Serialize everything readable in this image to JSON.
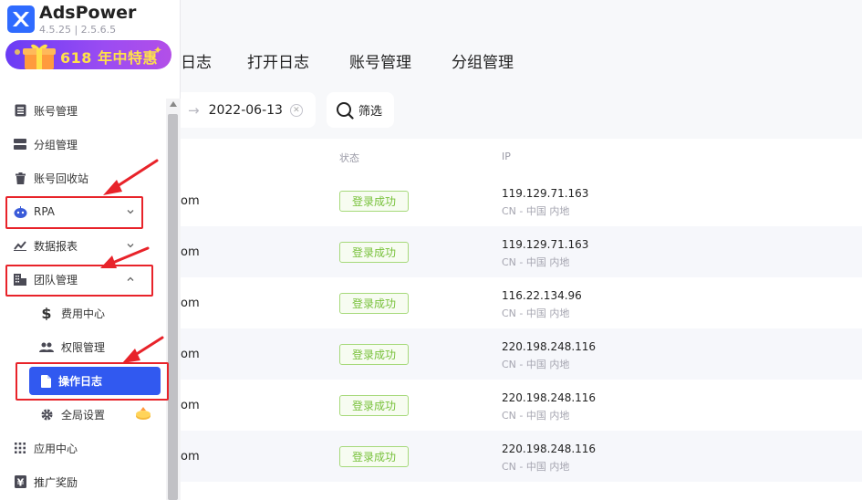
{
  "app": {
    "name": "AdsPower",
    "version": "4.5.25  |  2.5.6.5",
    "promo_text": "618 年中特惠"
  },
  "sidebar": {
    "items": [
      {
        "label": "账号管理",
        "icon": "account-list-icon"
      },
      {
        "label": "分组管理",
        "icon": "group-icon"
      },
      {
        "label": "账号回收站",
        "icon": "trash-icon"
      },
      {
        "label": "RPA",
        "icon": "rpa-robot-icon",
        "expandable": true
      },
      {
        "label": "数据报表",
        "icon": "chart-icon",
        "expandable": true
      },
      {
        "label": "团队管理",
        "icon": "team-building-icon",
        "expanded": true
      },
      {
        "label": "费用中心",
        "icon": "dollar-icon",
        "sub": true
      },
      {
        "label": "权限管理",
        "icon": "users-icon",
        "sub": true
      },
      {
        "label": "操作日志",
        "icon": "document-icon",
        "sub": true,
        "active": true
      },
      {
        "label": "全局设置",
        "icon": "gear-icon",
        "sub": true
      },
      {
        "label": "应用中心",
        "icon": "grid-icon"
      },
      {
        "label": "推广奖励",
        "icon": "yen-icon"
      }
    ]
  },
  "tabs": [
    {
      "label": "日志"
    },
    {
      "label": "打开日志"
    },
    {
      "label": "账号管理"
    },
    {
      "label": "分组管理"
    }
  ],
  "filter": {
    "date": "2022-06-13",
    "filter_label": "筛选"
  },
  "table": {
    "headers": {
      "status": "状态",
      "ip": "IP"
    },
    "rows": [
      {
        "email": "om",
        "status": "登录成功",
        "ip": "119.129.71.163",
        "location": "CN - 中国 内地"
      },
      {
        "email": "om",
        "status": "登录成功",
        "ip": "119.129.71.163",
        "location": "CN - 中国 内地"
      },
      {
        "email": "om",
        "status": "登录成功",
        "ip": "116.22.134.96",
        "location": "CN - 中国 内地"
      },
      {
        "email": "om",
        "status": "登录成功",
        "ip": "220.198.248.116",
        "location": "CN - 中国 内地"
      },
      {
        "email": "om",
        "status": "登录成功",
        "ip": "220.198.248.116",
        "location": "CN - 中国 内地"
      },
      {
        "email": "om",
        "status": "登录成功",
        "ip": "220.198.248.116",
        "location": "CN - 中国 内地"
      }
    ]
  },
  "colors": {
    "accent": "#3159f0",
    "annotation": "#e8232a",
    "success": "#78c13b"
  }
}
